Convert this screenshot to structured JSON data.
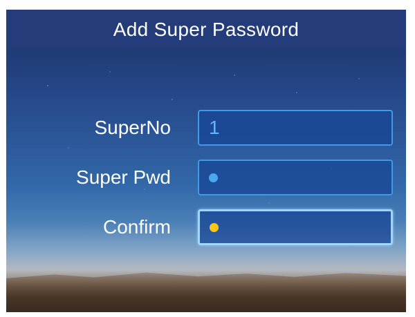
{
  "screen": {
    "title": "Add Super Password"
  },
  "form": {
    "super_no": {
      "label": "SuperNo",
      "value": "1"
    },
    "super_pwd": {
      "label": "Super Pwd",
      "masked_chars": 1,
      "dot_color": "#4aa8f0"
    },
    "confirm": {
      "label": "Confirm",
      "masked_chars": 1,
      "dot_color": "#ffc61a"
    }
  },
  "colors": {
    "title_bar": "#243c7a",
    "field_border": "#3f9be6",
    "field_border_active": "#9fd6ff",
    "field_text": "#5fb8ff"
  }
}
